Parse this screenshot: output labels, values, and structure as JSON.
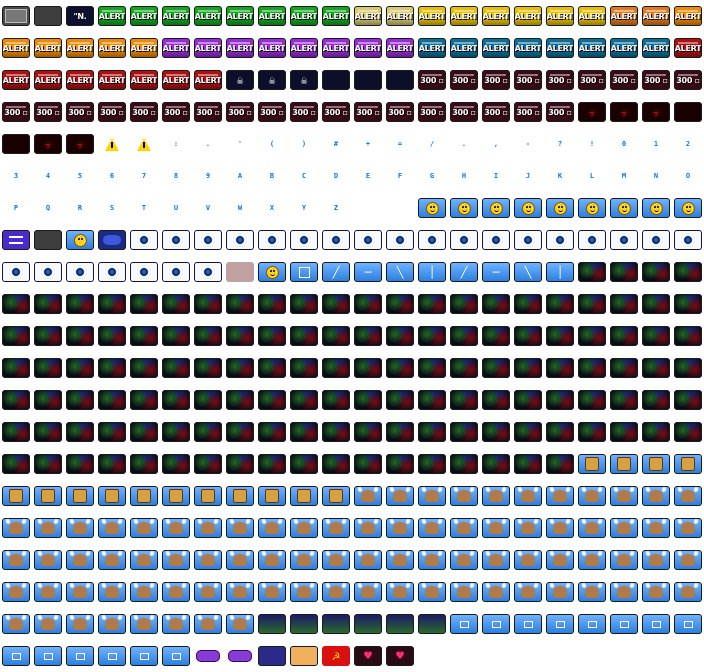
{
  "alert_label": "ALERT",
  "counter_label": "300 ▫",
  "logo_text": "\"N.",
  "font_glyphs": [
    ":",
    ".",
    "'",
    "(",
    ")",
    "#",
    "+",
    "=",
    "/",
    ".",
    ",",
    "-",
    "?",
    "!",
    "0",
    "1",
    "2",
    "3",
    "4",
    "5",
    "6",
    "7",
    "8",
    "9",
    "A",
    "B",
    "C",
    "D",
    "E",
    "F",
    "G",
    "H",
    "I",
    "J",
    "K",
    "L",
    "M",
    "N",
    "O",
    "P",
    "Q",
    "R",
    "S",
    "T",
    "U",
    "V",
    "W",
    "X",
    "Y",
    "Z"
  ],
  "colors": {
    "green": "#12a81e",
    "yellow": "#e8c000",
    "orange": "#f08a00",
    "purple": "#9b2ad8",
    "teal": "#0a6f9a",
    "red": "#b01010",
    "dark_navy": "#0d0f2a",
    "maroon": "#3a0a14",
    "sky": "#3c8ee8",
    "glyph": "#1e6fd0"
  }
}
